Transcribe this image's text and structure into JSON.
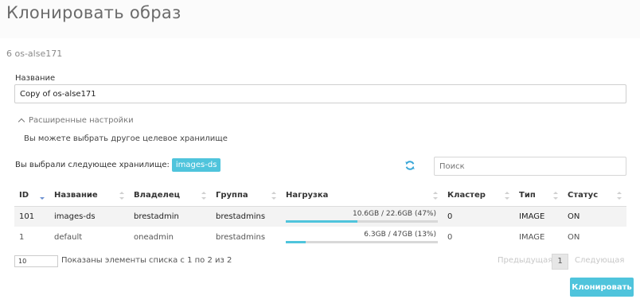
{
  "header": {
    "title": "Клонировать образ"
  },
  "subtitle": "6 os-alse171",
  "name_field": {
    "label": "Название",
    "value": "Copy of os-alse171"
  },
  "advanced": {
    "label": "Расширенные настройки"
  },
  "hint": "Вы можете выбрать другое целевое хранилище",
  "selected": {
    "text": "Вы выбрали следующее хранилище:",
    "badge": "images-ds"
  },
  "search": {
    "placeholder": "Поиск"
  },
  "table": {
    "headers": [
      "ID",
      "Название",
      "Владелец",
      "Группа",
      "Нагрузка",
      "Кластер",
      "Тип",
      "Статус"
    ],
    "rows": [
      {
        "id": "101",
        "name": "images-ds",
        "owner": "brestadmin",
        "group": "brestadmins",
        "load": "10.6GB / 22.6GB (47%)",
        "load_pct": 47,
        "cluster": "0",
        "type": "IMAGE",
        "status": "ON"
      },
      {
        "id": "1",
        "name": "default",
        "owner": "oneadmin",
        "group": "brestadmins",
        "load": "6.3GB / 47GB (13%)",
        "load_pct": 13,
        "cluster": "0",
        "type": "IMAGE",
        "status": "ON"
      }
    ]
  },
  "footer": {
    "per_page": "10",
    "shown": "Показаны элементы списка с 1 по 2 из 2",
    "prev": "Предыдущая",
    "page": "1",
    "next": "Следующая"
  },
  "clone_button": "Клонировать",
  "colors": {
    "accent": "#4fc4dc"
  }
}
